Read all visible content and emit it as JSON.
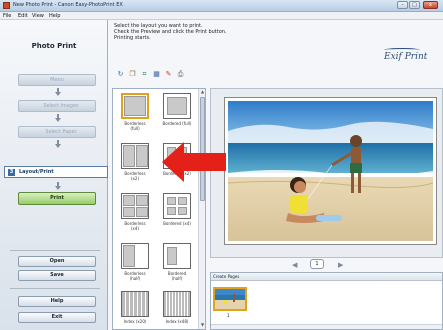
{
  "window": {
    "title": "New Photo Print - Canon Easy-PhotoPrint EX",
    "buttons": {
      "minimize": "–",
      "maximize": "□",
      "close": "x"
    }
  },
  "menu": [
    "File",
    "Edit",
    "View",
    "Help"
  ],
  "sidebar": {
    "heading": "Photo Print",
    "steps": [
      {
        "label": "Menu"
      },
      {
        "label": "Select Images",
        "num": "1"
      },
      {
        "label": "Select Paper",
        "num": "2"
      },
      {
        "label": "Layout/Print",
        "num": "3"
      }
    ],
    "print_label": "Print",
    "open_label": "Open",
    "save_label": "Save",
    "help_label": "Help",
    "exit_label": "Exit"
  },
  "main": {
    "instructions": "Select the layout you want to print.\nCheck the Preview and click the Print button.\nPrinting starts.",
    "logo_text": "Exif Print",
    "toolbar_icons": [
      "rotate-icon",
      "copy-icon",
      "crop-icon",
      "image-adjust-icon",
      "correct-icon",
      "print-settings-icon"
    ],
    "layouts": [
      {
        "label": "Borderless\n(full)",
        "selected": true
      },
      {
        "label": "Bordered (full)"
      },
      {
        "label": "Borderless\n(x2)"
      },
      {
        "label": "Bordered (x2)"
      },
      {
        "label": "Borderless\n(x4)"
      },
      {
        "label": "Bordered (x4)"
      },
      {
        "label": "Borderless\n(half)"
      },
      {
        "label": "Bordered\n(half)"
      },
      {
        "label": "Index (x20)"
      },
      {
        "label": "Index (x48)"
      }
    ],
    "pager": {
      "prev": "◀",
      "page": "1",
      "next": "▶"
    },
    "pages_header": "Create Pages",
    "page_number": "1"
  },
  "colors": {
    "accent_selected": "#e0a21c",
    "print_button": "#98cc6a",
    "callout_arrow": "#e32119"
  }
}
